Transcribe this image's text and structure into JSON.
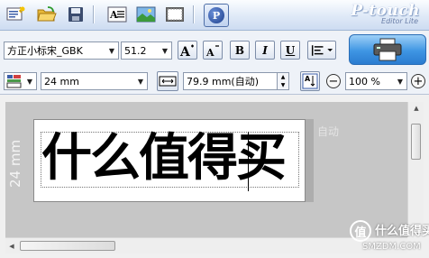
{
  "app": {
    "brand": "P-touch",
    "brand_sub": "Editor Lite"
  },
  "toolbar": {
    "icons": [
      "new-label-icon",
      "open-folder-icon",
      "save-disk-icon",
      "text-icon",
      "picture-icon",
      "frame-icon",
      "ptouch-logo-icon"
    ]
  },
  "format": {
    "font_name": "方正小标宋_GBK",
    "font_size": "51.2",
    "bold_label": "B",
    "italic_label": "I",
    "underline_label": "U",
    "tape_width": "24 mm",
    "label_length": "79.9 mm(自动)",
    "zoom": "100 %"
  },
  "canvas": {
    "ruler_label": "24 mm",
    "auto_label": "自动",
    "label_text": "什么值得买"
  },
  "watermark": {
    "logo": "值",
    "text": "什么值得买",
    "url": "SMZDM.COM"
  },
  "colors": {
    "toolbar_bg": "#dfe9f7",
    "canvas_bg": "#c6c6c6",
    "print_button": "#3e95e3"
  }
}
